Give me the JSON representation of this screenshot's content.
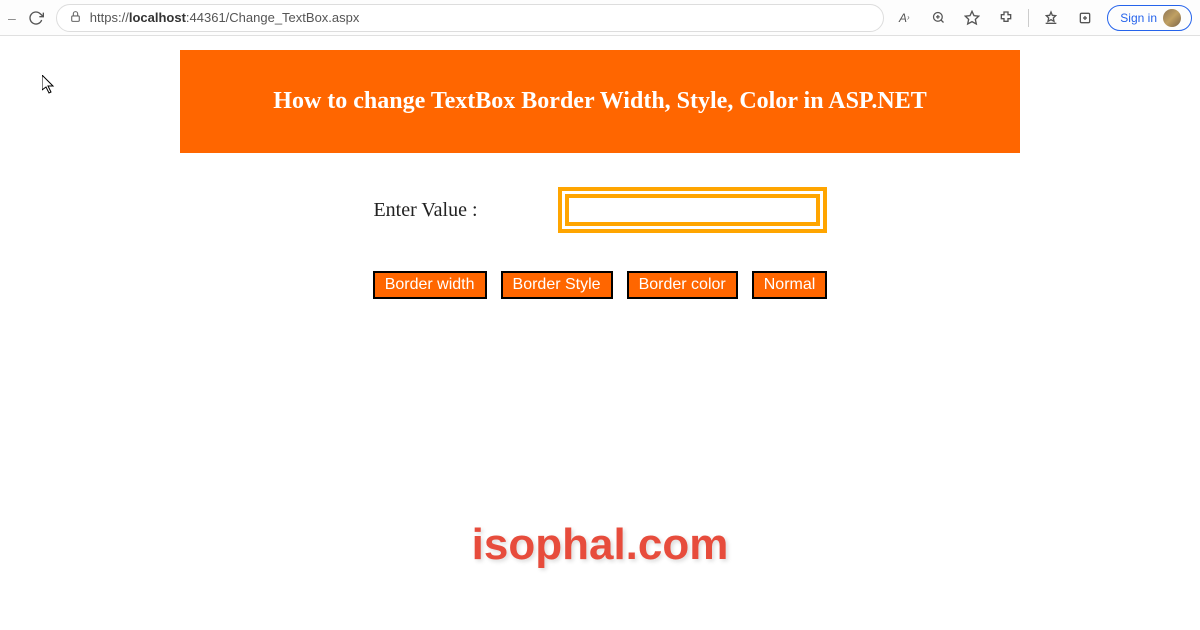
{
  "browser": {
    "url_prefix": "https://",
    "url_host": "localhost",
    "url_port": ":44361",
    "url_path": "/Change_TextBox.aspx",
    "signin_label": "Sign in"
  },
  "page": {
    "banner_title": "How to change TextBox Border Width, Style, Color in ASP.NET",
    "input_label": "Enter Value :",
    "input_value": ""
  },
  "buttons": {
    "border_width": "Border width",
    "border_style": "Border Style",
    "border_color": "Border color",
    "normal": "Normal"
  },
  "watermark": "isophal.com"
}
